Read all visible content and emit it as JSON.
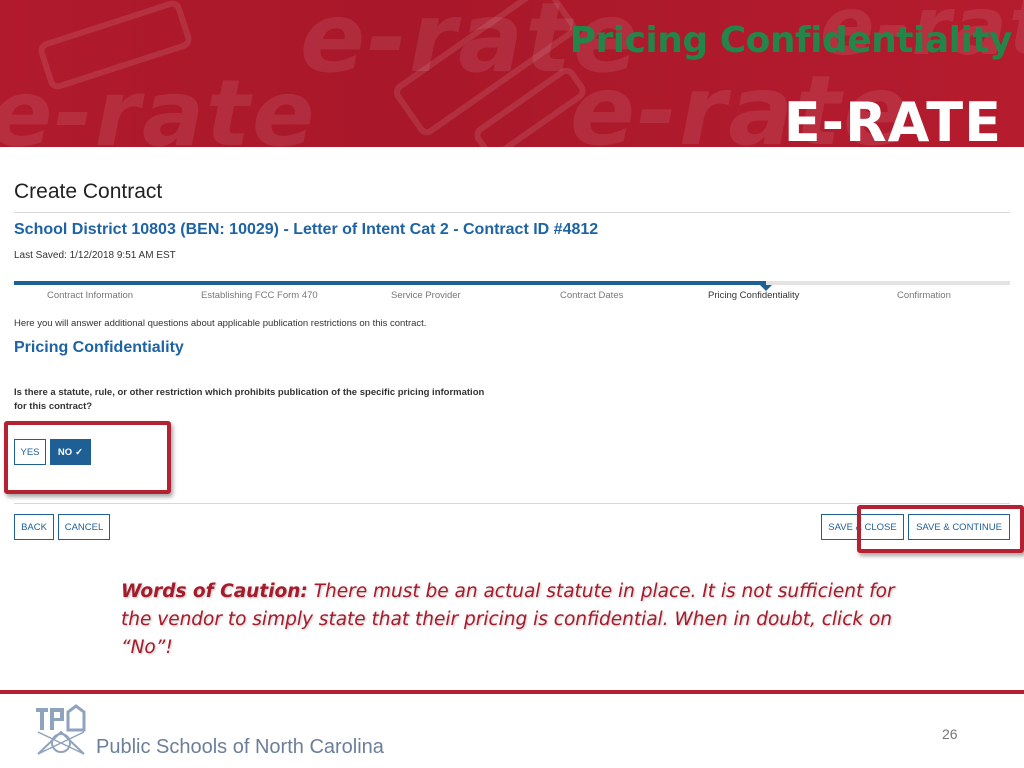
{
  "slide": {
    "title": "Pricing Confidentiality",
    "banner_logo_text": "E-RATE",
    "banner_watermark_text": "e-rate",
    "page_number": "26",
    "footer_org": "Public Schools of North Carolina"
  },
  "form": {
    "heading": "Create Contract",
    "contract_title": "School District 10803 (BEN: 10029) - Letter of Intent Cat 2 - Contract ID #4812",
    "last_saved": "Last Saved: 1/12/2018 9:51 AM EST",
    "progress_fraction": 0.755,
    "steps": [
      {
        "label": "Contract Information",
        "active": false
      },
      {
        "label": "Establishing FCC Form 470",
        "active": false
      },
      {
        "label": "Service Provider",
        "active": false
      },
      {
        "label": "Contract Dates",
        "active": false
      },
      {
        "label": "Pricing Confidentiality",
        "active": true
      },
      {
        "label": "Confirmation",
        "active": false
      }
    ],
    "intro": "Here you will answer additional questions about applicable publication restrictions on this contract.",
    "section_title": "Pricing Confidentiality",
    "question": "Is there a statute, rule, or other restriction which prohibits publication of the specific pricing information for this contract?",
    "options": {
      "yes": "YES",
      "no": "NO",
      "selected": "no"
    },
    "buttons": {
      "back": "BACK",
      "cancel": "CANCEL",
      "save_close": "SAVE & CLOSE",
      "save_continue": "SAVE & CONTINUE"
    }
  },
  "caution": {
    "label": "Words of Caution:",
    "text": " There must be an actual statute in place. It is not sufficient for the vendor to simply state that their pricing is confidential. When in doubt, click on “No”!"
  },
  "colors": {
    "banner_red": "#b01a2c",
    "title_green": "#23854a",
    "link_blue": "#1e63a3",
    "button_blue": "#1e5f96",
    "highlight_red": "#b22232",
    "caution_red": "#a51b2b"
  },
  "icons": {
    "check": "check-icon",
    "logo": "dpi-logo-icon"
  }
}
